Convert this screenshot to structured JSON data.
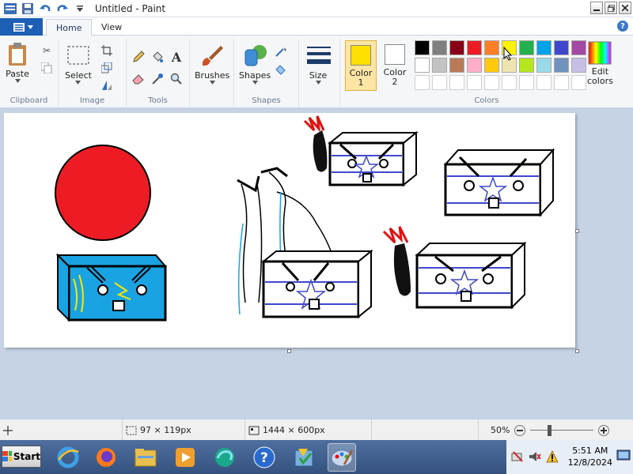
{
  "window": {
    "title": "Untitled - Paint"
  },
  "tabs": {
    "file_label": "",
    "home": "Home",
    "view": "View"
  },
  "ribbon": {
    "clipboard": {
      "paste": "Paste",
      "label": "Clipboard"
    },
    "image": {
      "select": "Select",
      "label": "Image"
    },
    "tools": {
      "label": "Tools"
    },
    "brushes": {
      "label": "Brushes"
    },
    "shapes": {
      "label": "Shapes",
      "group_label": "Shapes"
    },
    "size": {
      "label": "Size"
    },
    "colors": {
      "color1_label": "Color 1",
      "color1_line1": "Color",
      "color1_line2": "1",
      "color2_line1": "Color",
      "color2_line2": "2",
      "color1_value": "#ffe000",
      "color2_value": "#ffffff",
      "edit_line1": "Edit",
      "edit_line2": "colors",
      "label": "Colors",
      "palette_row1": [
        "#000000",
        "#7f7f7f",
        "#880015",
        "#ed1c24",
        "#ff7f27",
        "#fff200",
        "#22b14c",
        "#00a2e8",
        "#3f48cc",
        "#a349a4"
      ],
      "palette_row2": [
        "#ffffff",
        "#c3c3c3",
        "#b97a57",
        "#ffaec9",
        "#ffc90e",
        "#efe4b0",
        "#b5e61d",
        "#99d9ea",
        "#7092be",
        "#c8bfe7"
      ],
      "palette_row3": [
        "#ffffff",
        "#ffffff",
        "#ffffff",
        "#ffffff",
        "#ffffff",
        "#ffffff",
        "#ffffff",
        "#ffffff",
        "#ffffff",
        "#ffffff"
      ]
    }
  },
  "status": {
    "selection_size": "97 × 119px",
    "image_size": "1444 × 600px",
    "zoom": "50%"
  },
  "taskbar": {
    "start": "Start",
    "time": "5:51 AM",
    "date": "12/8/2024"
  }
}
